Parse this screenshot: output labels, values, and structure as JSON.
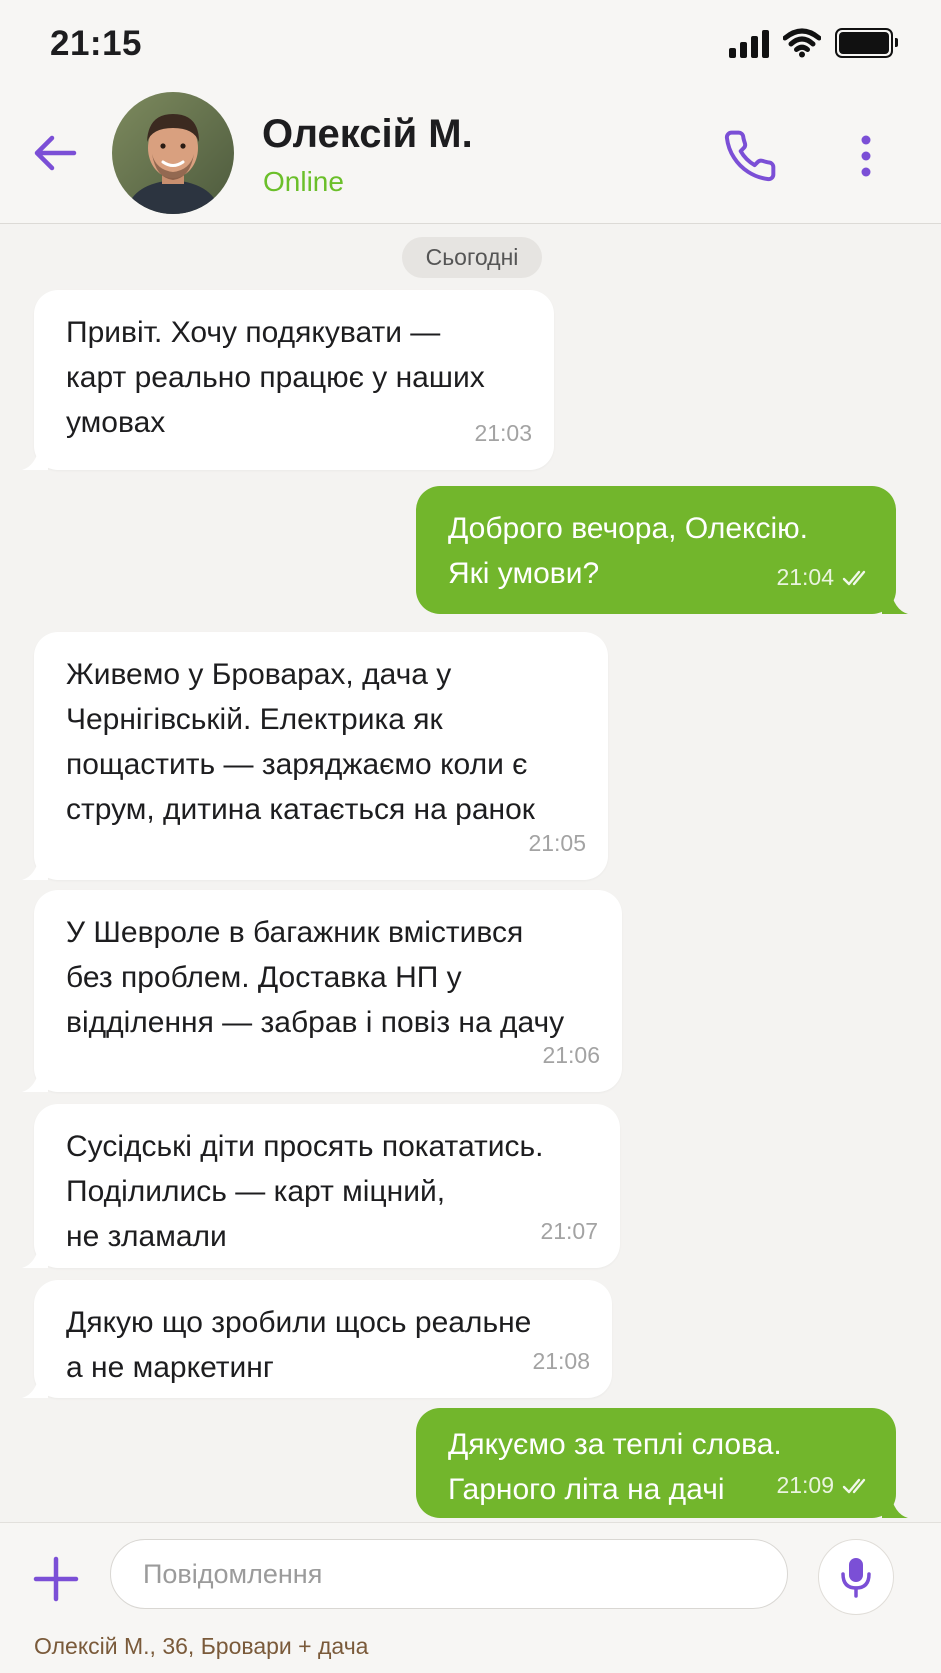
{
  "status_bar": {
    "time": "21:15"
  },
  "header": {
    "contact_name": "Олексій М.",
    "contact_status": "Online"
  },
  "chat": {
    "date_label": "Сьогодні",
    "messages": [
      {
        "direction": "in",
        "text": "Привіт. Хочу подякувати —\nкарт реально працює у наших\nумовах",
        "time": "21:03"
      },
      {
        "direction": "out",
        "text": "Доброго вечора, Олексію.\nЯкі умови?",
        "time": "21:04",
        "read": true
      },
      {
        "direction": "in",
        "text": "Живемо у Броварах, дача у\nЧернігівській. Електрика як\nпощастить — заряджаємо коли є\nструм, дитина катається на ранок",
        "time": "21:05"
      },
      {
        "direction": "in",
        "text": "У Шевроле в багажник вмістився\nбез проблем. Доставка НП у\nвідділення — забрав і повіз на дачу",
        "time": "21:06"
      },
      {
        "direction": "in",
        "text": "Сусідські діти просять покататись.\nПоділились — карт міцний,\nне зламали",
        "time": "21:07"
      },
      {
        "direction": "in",
        "text": "Дякую що зробили щось реальне\nа не маркетинг",
        "time": "21:08"
      },
      {
        "direction": "out",
        "text": "Дякуємо за теплі слова.\nГарного літа на дачі",
        "time": "21:09",
        "read": true
      }
    ]
  },
  "composer": {
    "placeholder": "Повідомлення",
    "caption": "Олексій М., 36, Бровари + дача"
  },
  "icons": {
    "back": "arrow-left-icon",
    "call": "phone-icon",
    "menu": "more-vertical-icon",
    "attach": "plus-icon",
    "voice": "microphone-icon",
    "read_receipt": "double-check-icon"
  },
  "colors": {
    "accent": "#7b4fd6",
    "outgoing_bubble": "#72b62c",
    "online": "#6bbf2a",
    "background": "#f4f3f1"
  }
}
